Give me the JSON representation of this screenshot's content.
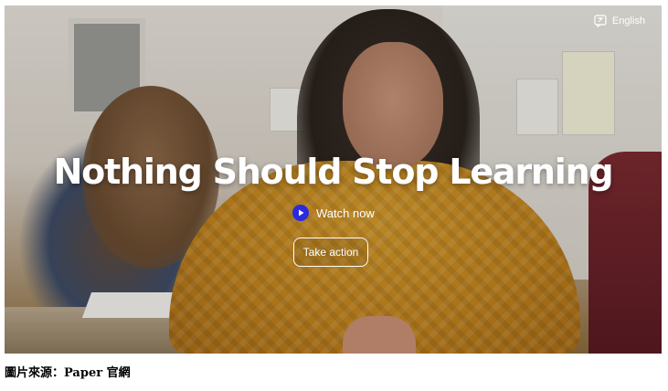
{
  "hero": {
    "language_label": "English",
    "language_icon": "translate-icon",
    "headline": "Nothing Should Stop Learning",
    "watch_label": "Watch now",
    "watch_icon": "play-icon",
    "cta_label": "Take action"
  },
  "caption": {
    "text": "圖片來源：Paper 官網"
  },
  "colors": {
    "play_button": "#2a2ae0",
    "text_on_image": "#ffffff"
  }
}
